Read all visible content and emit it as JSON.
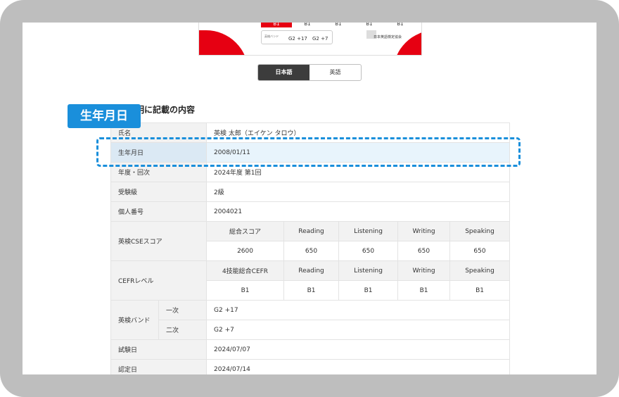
{
  "certificate": {
    "cefr_label": "CEFRレベル",
    "cefr_values": [
      "B1",
      "B1",
      "B1",
      "B1",
      "B1"
    ],
    "band_label": "英検バンド",
    "band_values": [
      "G2 +17",
      "G2 +7"
    ],
    "issuer": "日本英語検定協会"
  },
  "language_toggle": {
    "japanese": "日本語",
    "english": "英語"
  },
  "section": {
    "title": "ネル証明に記載の内容",
    "callout": "生年月日"
  },
  "rows": {
    "name": {
      "label": "氏名",
      "value": "英検 太郎（エイケン タロウ）"
    },
    "birthdate": {
      "label": "生年月日",
      "value": "2008/01/11"
    },
    "exam_session": {
      "label": "年度・回次",
      "value": "2024年度 第1回"
    },
    "grade": {
      "label": "受験級",
      "value": "2級"
    },
    "personal_number": {
      "label": "個人番号",
      "value": "2004021"
    },
    "cse": {
      "label": "英検CSEスコア",
      "headers": [
        "総合スコア",
        "Reading",
        "Listening",
        "Writing",
        "Speaking"
      ],
      "values": [
        "2600",
        "650",
        "650",
        "650",
        "650"
      ]
    },
    "cefr": {
      "label": "CEFRレベル",
      "headers": [
        "4技能総合CEFR",
        "Reading",
        "Listening",
        "Writing",
        "Speaking"
      ],
      "values": [
        "B1",
        "B1",
        "B1",
        "B1",
        "B1"
      ]
    },
    "band": {
      "label": "英検バンド",
      "first_label": "一次",
      "first_value": "G2 +17",
      "second_label": "二次",
      "second_value": "G2 +7"
    },
    "exam_date": {
      "label": "試験日",
      "value": "2024/07/07"
    },
    "result_date": {
      "label": "認定日",
      "value": "2024/07/14"
    }
  },
  "colors": {
    "accent_blue": "#1a8fdb",
    "brand_red": "#e60012",
    "toggle_active": "#3c3c3c"
  }
}
